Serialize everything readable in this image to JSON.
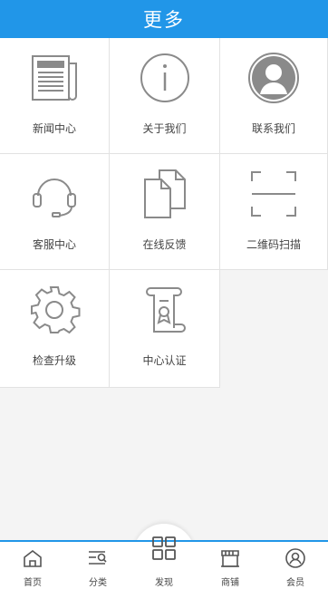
{
  "header": {
    "title": "更多"
  },
  "grid": [
    {
      "label": "新闻中心",
      "icon": "newspaper-icon"
    },
    {
      "label": "关于我们",
      "icon": "info-icon"
    },
    {
      "label": "联系我们",
      "icon": "contact-avatar-icon"
    },
    {
      "label": "客服中心",
      "icon": "headset-icon"
    },
    {
      "label": "在线反馈",
      "icon": "documents-icon"
    },
    {
      "label": "二维码扫描",
      "icon": "scan-frame-icon"
    },
    {
      "label": "检查升级",
      "icon": "gear-icon"
    },
    {
      "label": "中心认证",
      "icon": "certificate-scroll-icon"
    }
  ],
  "tabbar": [
    {
      "label": "首页",
      "icon": "home-icon"
    },
    {
      "label": "分类",
      "icon": "category-search-icon"
    },
    {
      "label": "发现",
      "icon": "discover-grid-icon"
    },
    {
      "label": "商铺",
      "icon": "shop-icon"
    },
    {
      "label": "会员",
      "icon": "member-icon"
    }
  ],
  "colors": {
    "accent": "#2196e8",
    "icon_stroke": "#8a8a8a",
    "text": "#444444"
  }
}
